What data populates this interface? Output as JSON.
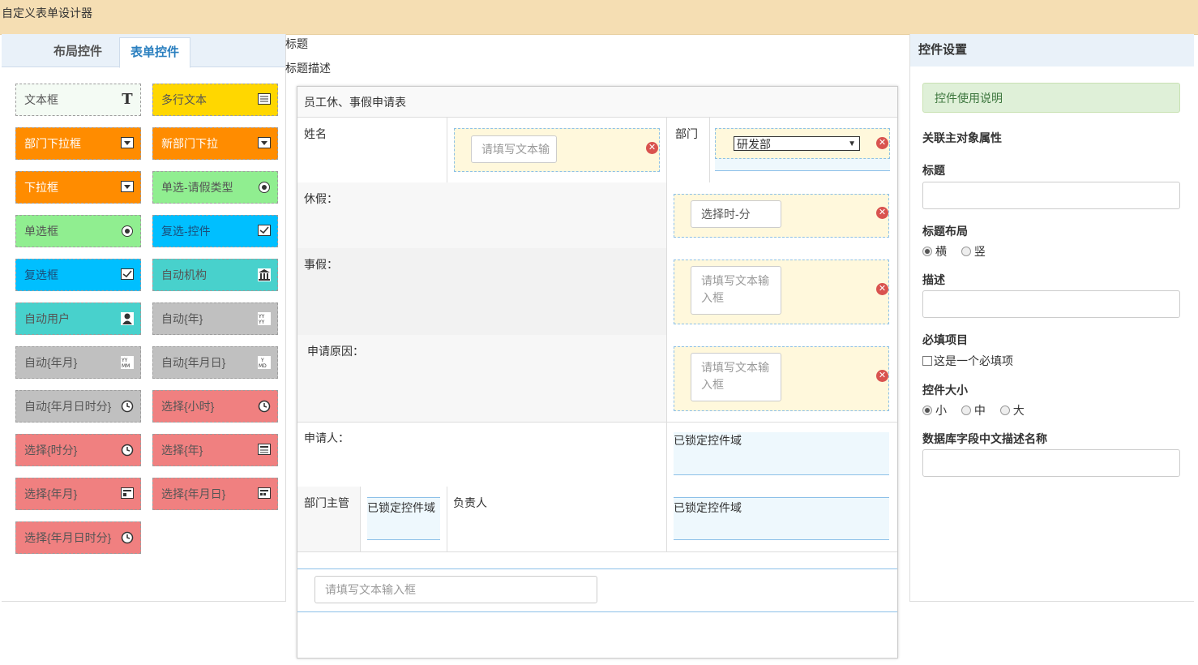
{
  "app": {
    "title": "自定义表单设计器"
  },
  "left": {
    "tabs": [
      {
        "label": "布局控件"
      },
      {
        "label": "表单控件"
      }
    ],
    "controls": [
      {
        "label": "文本框",
        "icon": "text-icon"
      },
      {
        "label": "多行文本",
        "icon": "textarea-icon"
      },
      {
        "label": "部门下拉框",
        "icon": "dropdown-icon"
      },
      {
        "label": "新部门下拉",
        "icon": "dropdown-icon"
      },
      {
        "label": "下拉框",
        "icon": "dropdown-icon"
      },
      {
        "label": "单选-请假类型",
        "icon": "radio-icon"
      },
      {
        "label": "单选框",
        "icon": "radio-icon"
      },
      {
        "label": "复选-控件",
        "icon": "checkbox-icon"
      },
      {
        "label": "复选框",
        "icon": "checkbox-icon"
      },
      {
        "label": "自动机构",
        "icon": "building-icon"
      },
      {
        "label": "自动用户",
        "icon": "user-icon"
      },
      {
        "label": "自动{年}",
        "icon": "year-icon"
      },
      {
        "label": "自动{年月}",
        "icon": "year-month-icon"
      },
      {
        "label": "自动{年月日}",
        "icon": "date-icon"
      },
      {
        "label": "自动{年月日时分}",
        "icon": "clock-icon"
      },
      {
        "label": "选择{小时}",
        "icon": "clock-icon"
      },
      {
        "label": "选择{时分}",
        "icon": "clock-icon"
      },
      {
        "label": "选择{年}",
        "icon": "calendar-icon"
      },
      {
        "label": "选择{年月}",
        "icon": "calendar-icon"
      },
      {
        "label": "选择{年月日}",
        "icon": "calendar-icon"
      },
      {
        "label": "选择{年月日时分}",
        "icon": "clock-icon"
      }
    ],
    "colors": {
      "yellow": "#ffd700",
      "orange": "#ff8c00",
      "green": "#90ee90",
      "blue": "#00bfff",
      "teal": "#48d1cc",
      "gray": "#c0c0c0",
      "red": "#f08080"
    }
  },
  "middle": {
    "title": "标题",
    "desc": "标题描述",
    "form_title": "员工休、事假申请表",
    "name_label": "姓名",
    "name_placeholder": "请填写文本输",
    "dept_label": "部门",
    "dept_value": "研发部",
    "leave_label": "休假：",
    "leave_placeholder": "选择时-分",
    "personal_label": "事假：",
    "personal_placeholder": "请填写文本输入框",
    "reason_label": "申请原因：",
    "reason_placeholder": "请填写文本输入框",
    "applicant_label": "申请人：",
    "locked_text": "已锁定控件域",
    "manager_label": "部门主管",
    "owner_label": "负责人",
    "bottom_placeholder": "请填写文本输入框"
  },
  "right": {
    "header": "控件设置",
    "note": "控件使用说明",
    "section": "关联主对象属性",
    "title_label": "标题",
    "layout_label": "标题布局",
    "layout_options": [
      "横",
      "竖"
    ],
    "desc_label": "描述",
    "required_label": "必填项目",
    "required_check": "这是一个必填项",
    "size_label": "控件大小",
    "size_options": [
      "小",
      "中",
      "大"
    ],
    "db_label": "数据库字段中文描述名称"
  }
}
